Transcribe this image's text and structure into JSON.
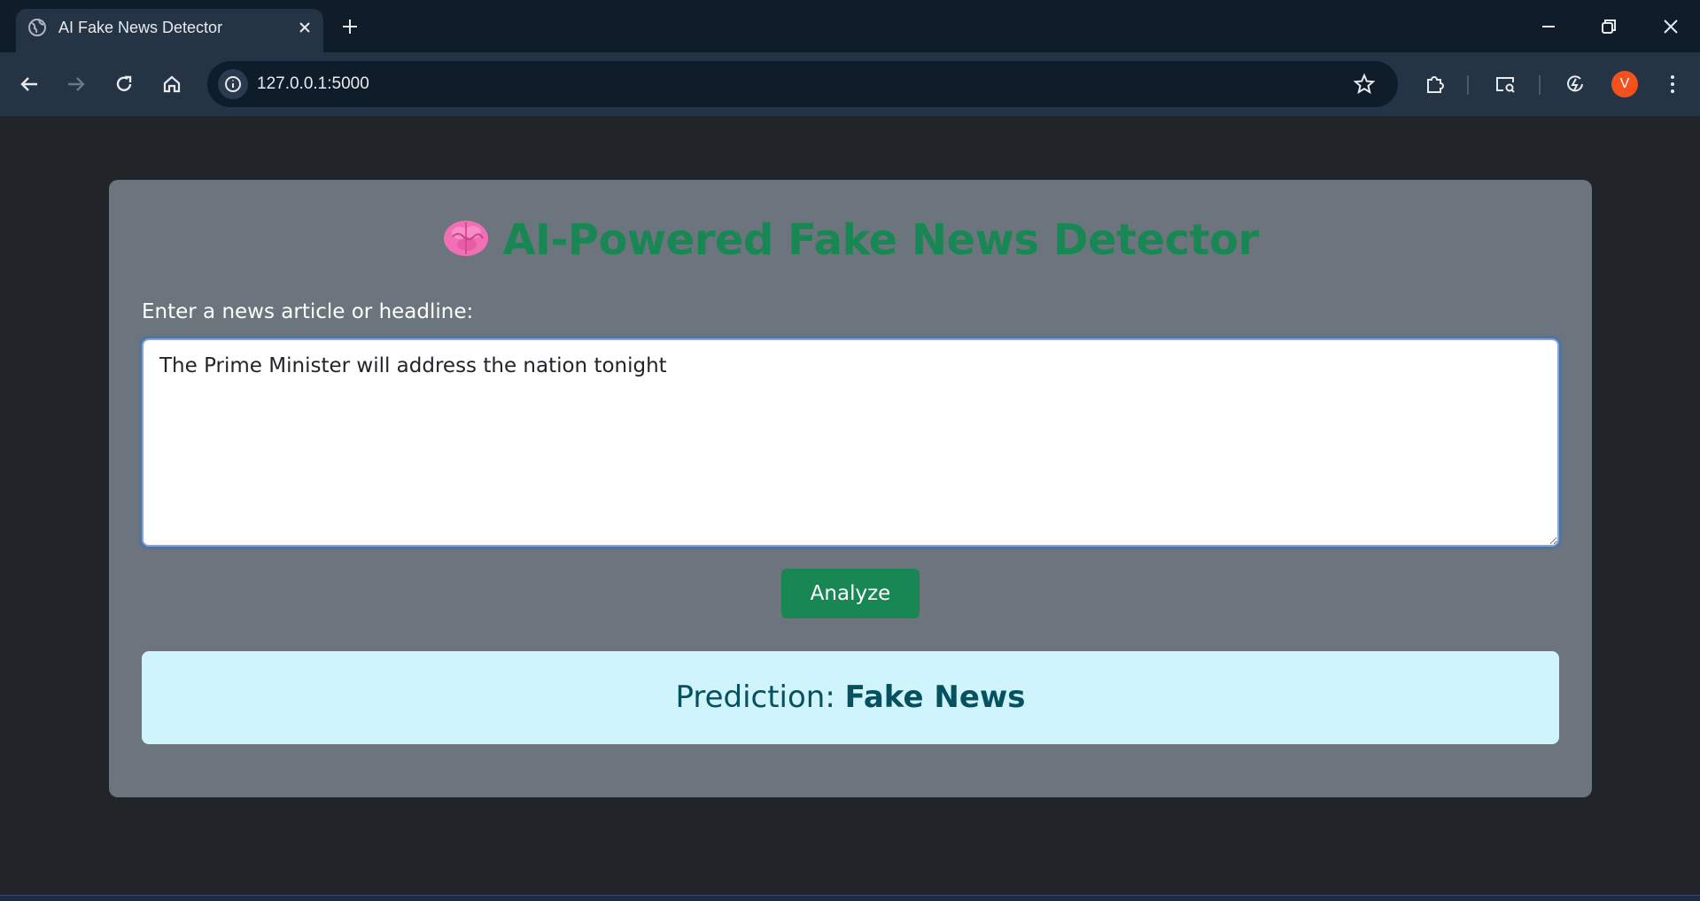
{
  "browser": {
    "tab_title": "AI Fake News Detector",
    "url": "127.0.0.1:5000",
    "profile_initial": "V",
    "accent_color": "#f4511e"
  },
  "page": {
    "heading_icon": "brain-emoji",
    "heading": "AI-Powered Fake News Detector",
    "input_label": "Enter a news article or headline:",
    "input_value": "The Prime Minister will address the nation tonight",
    "analyze_label": "Analyze",
    "prediction_prefix": "Prediction: ",
    "prediction_value": "Fake News",
    "colors": {
      "heading": "#198754",
      "button": "#198754",
      "result_background": "#cff4fc",
      "result_text": "#055160",
      "card": "#6c757d"
    }
  }
}
